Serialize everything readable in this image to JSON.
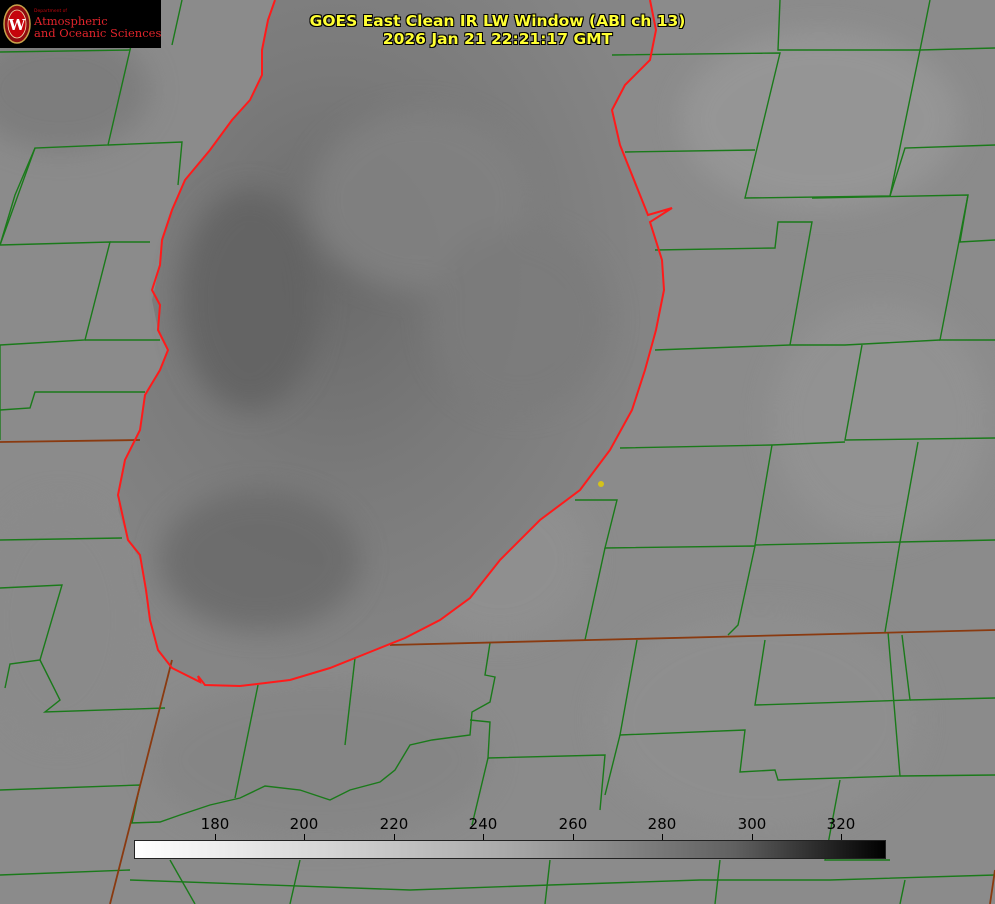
{
  "logo": {
    "department": "Department of",
    "line1": "Atmospheric",
    "line2": "and Oceanic Sciences",
    "seal_letter": "W"
  },
  "title": {
    "line1": "GOES East Clean IR LW Window (ABI ch 13)",
    "line2": "2026 Jan 21 22:21:17 GMT"
  },
  "colorbar": {
    "ticks": [
      "180",
      "200",
      "220",
      "240",
      "260",
      "280",
      "300",
      "320"
    ],
    "colors": {
      "low": "#ffffff",
      "high": "#000000"
    }
  },
  "colors": {
    "county_border": "#1a7a1a",
    "state_border": "#8a3a10",
    "coastline": "#ff1a1a",
    "title_text": "#ffff33",
    "marker": "#d4c21a"
  }
}
